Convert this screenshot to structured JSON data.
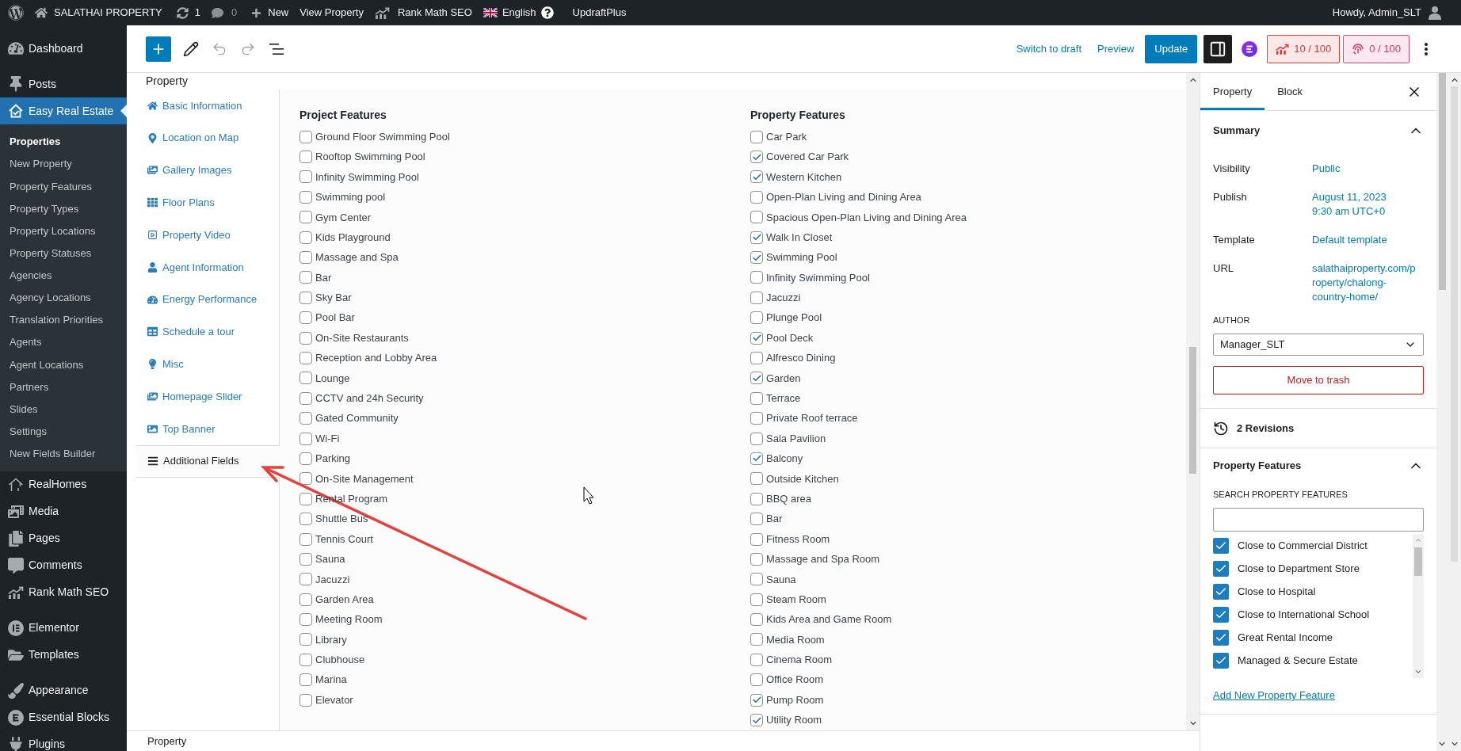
{
  "admin_bar": {
    "site_name": "SALATHAI PROPERTY",
    "updates": "1",
    "comments": "0",
    "new_label": "New",
    "view_label": "View Property",
    "seo_label": "Rank Math SEO",
    "language": "English",
    "backup_label": "UpdraftPlus",
    "greeting": "Howdy, Admin_SLT"
  },
  "admin_menu": {
    "groups": [
      {
        "items": [
          {
            "label": "Dashboard",
            "selected": false
          }
        ]
      },
      {
        "items": [
          {
            "label": "Posts",
            "selected": false
          },
          {
            "label": "Easy Real Estate",
            "selected": true,
            "children": [
              {
                "label": "Properties",
                "selected": true
              },
              {
                "label": "New Property",
                "selected": false
              },
              {
                "label": "Property Features",
                "selected": false
              },
              {
                "label": "Property Types",
                "selected": false
              },
              {
                "label": "Property Locations",
                "selected": false
              },
              {
                "label": "Property Statuses",
                "selected": false
              },
              {
                "label": "Agencies",
                "selected": false
              },
              {
                "label": "Agency Locations",
                "selected": false
              },
              {
                "label": "Translation Priorities",
                "selected": false
              },
              {
                "label": "Agents",
                "selected": false
              },
              {
                "label": "Agent Locations",
                "selected": false
              },
              {
                "label": "Partners",
                "selected": false
              },
              {
                "label": "Slides",
                "selected": false
              },
              {
                "label": "Settings",
                "selected": false
              },
              {
                "label": "New Fields Builder",
                "selected": false
              }
            ]
          },
          {
            "label": "RealHomes",
            "selected": false
          },
          {
            "label": "Media",
            "selected": false
          },
          {
            "label": "Pages",
            "selected": false
          },
          {
            "label": "Comments",
            "selected": false
          },
          {
            "label": "Rank Math SEO",
            "selected": false
          }
        ]
      },
      {
        "items": [
          {
            "label": "Elementor",
            "selected": false
          },
          {
            "label": "Templates",
            "selected": false
          }
        ]
      },
      {
        "items": [
          {
            "label": "Appearance",
            "selected": false
          },
          {
            "label": "Essential Blocks",
            "selected": false
          },
          {
            "label": "Plugins",
            "selected": false
          }
        ]
      }
    ]
  },
  "editor_toolbar": {
    "links": [
      {
        "label": "Switch to draft"
      },
      {
        "label": "Preview"
      }
    ],
    "update_button": "Update",
    "seo_score": "10 / 100",
    "readability_score": "0 / 100"
  },
  "metabox": {
    "title": "Property",
    "tabs": [
      {
        "label": "Basic Information",
        "selected": false
      },
      {
        "label": "Location on Map",
        "selected": false
      },
      {
        "label": "Gallery Images",
        "selected": false
      },
      {
        "label": "Floor Plans",
        "selected": false
      },
      {
        "label": "Property Video",
        "selected": false
      },
      {
        "label": "Agent Information",
        "selected": false
      },
      {
        "label": "Energy Performance",
        "selected": false
      },
      {
        "label": "Schedule a tour",
        "selected": false
      },
      {
        "label": "Misc",
        "selected": false
      },
      {
        "label": "Homepage Slider",
        "selected": false
      },
      {
        "label": "Top Banner",
        "selected": false
      },
      {
        "label": "Additional Fields",
        "selected": true
      }
    ],
    "field_groups": [
      {
        "title": "Project Features",
        "options": [
          {
            "label": "Ground Floor Swimming Pool",
            "checked": false
          },
          {
            "label": "Rooftop Swimming Pool",
            "checked": false
          },
          {
            "label": "Infinity Swimming Pool",
            "checked": false
          },
          {
            "label": "Swimming pool",
            "checked": false
          },
          {
            "label": "Gym Center",
            "checked": false
          },
          {
            "label": "Kids Playground",
            "checked": false
          },
          {
            "label": "Massage and Spa",
            "checked": false
          },
          {
            "label": "Bar",
            "checked": false
          },
          {
            "label": "Sky Bar",
            "checked": false
          },
          {
            "label": "Pool Bar",
            "checked": false
          },
          {
            "label": "On-Site Restaurants",
            "checked": false
          },
          {
            "label": "Reception and Lobby Area",
            "checked": false
          },
          {
            "label": "Lounge",
            "checked": false
          },
          {
            "label": "CCTV and 24h Security",
            "checked": false
          },
          {
            "label": "Gated Community",
            "checked": false
          },
          {
            "label": "Wi-Fi",
            "checked": false
          },
          {
            "label": "Parking",
            "checked": false
          },
          {
            "label": "On-Site Management",
            "checked": false
          },
          {
            "label": "Rental Program",
            "checked": false
          },
          {
            "label": "Shuttle Bus",
            "checked": false
          },
          {
            "label": "Tennis Court",
            "checked": false
          },
          {
            "label": "Sauna",
            "checked": false
          },
          {
            "label": "Jacuzzi",
            "checked": false
          },
          {
            "label": "Garden Area",
            "checked": false
          },
          {
            "label": "Meeting Room",
            "checked": false
          },
          {
            "label": "Library",
            "checked": false
          },
          {
            "label": "Clubhouse",
            "checked": false
          },
          {
            "label": "Marina",
            "checked": false
          },
          {
            "label": "Elevator",
            "checked": false
          }
        ]
      },
      {
        "title": "Property Features",
        "options": [
          {
            "label": "Car Park",
            "checked": false
          },
          {
            "label": "Covered Car Park",
            "checked": true
          },
          {
            "label": "Western Kitchen",
            "checked": true
          },
          {
            "label": "Open-Plan Living and Dining Area",
            "checked": false
          },
          {
            "label": "Spacious Open-Plan Living and Dining Area",
            "checked": false
          },
          {
            "label": "Walk In Closet",
            "checked": true
          },
          {
            "label": "Swimming Pool",
            "checked": true
          },
          {
            "label": "Infinity Swimming Pool",
            "checked": false
          },
          {
            "label": "Jacuzzi",
            "checked": false
          },
          {
            "label": "Plunge Pool",
            "checked": false
          },
          {
            "label": "Pool Deck",
            "checked": true
          },
          {
            "label": "Alfresco Dining",
            "checked": false
          },
          {
            "label": "Garden",
            "checked": true
          },
          {
            "label": "Terrace",
            "checked": false
          },
          {
            "label": "Private Roof terrace",
            "checked": false
          },
          {
            "label": "Sala Pavilion",
            "checked": false
          },
          {
            "label": "Balcony",
            "checked": true
          },
          {
            "label": "Outside Kitchen",
            "checked": false
          },
          {
            "label": "BBQ area",
            "checked": false
          },
          {
            "label": "Bar",
            "checked": false
          },
          {
            "label": "Fitness Room",
            "checked": false
          },
          {
            "label": "Massage and Spa Room",
            "checked": false
          },
          {
            "label": "Sauna",
            "checked": false
          },
          {
            "label": "Steam Room",
            "checked": false
          },
          {
            "label": "Kids Area and Game Room",
            "checked": false
          },
          {
            "label": "Media Room",
            "checked": false
          },
          {
            "label": "Cinema Room",
            "checked": false
          },
          {
            "label": "Office Room",
            "checked": false
          },
          {
            "label": "Pump Room",
            "checked": true
          },
          {
            "label": "Utility Room",
            "checked": true
          }
        ]
      }
    ]
  },
  "breadcrumb": "Property",
  "settings_sidebar": {
    "tabs": [
      {
        "label": "Property",
        "selected": true
      },
      {
        "label": "Block",
        "selected": false
      }
    ],
    "summary": {
      "title": "Summary",
      "expanded": true,
      "rows": [
        {
          "label": "Visibility",
          "value": "Public"
        },
        {
          "label": "Publish",
          "value": "August 11, 2023\n9:30 am UTC+0"
        },
        {
          "label": "Template",
          "value": "Default template"
        },
        {
          "label": "URL",
          "value": "salathaiproperty.com/property/chalong-country-home/"
        }
      ],
      "author_label": "AUTHOR",
      "author": "Manager_SLT",
      "trash_button": "Move to trash"
    },
    "revisions": "2 Revisions",
    "features_panel": {
      "title": "Property Features",
      "expanded": true,
      "search_label": "SEARCH PROPERTY FEATURES",
      "items": [
        {
          "label": "Close to Commercial District",
          "checked": true
        },
        {
          "label": "Close to Department Store",
          "checked": true
        },
        {
          "label": "Close to Hospital",
          "checked": true
        },
        {
          "label": "Close to International School",
          "checked": true
        },
        {
          "label": "Great Rental Income",
          "checked": true
        },
        {
          "label": "Managed & Secure Estate",
          "checked": true
        }
      ],
      "add_link": "Add New Property Feature"
    }
  }
}
